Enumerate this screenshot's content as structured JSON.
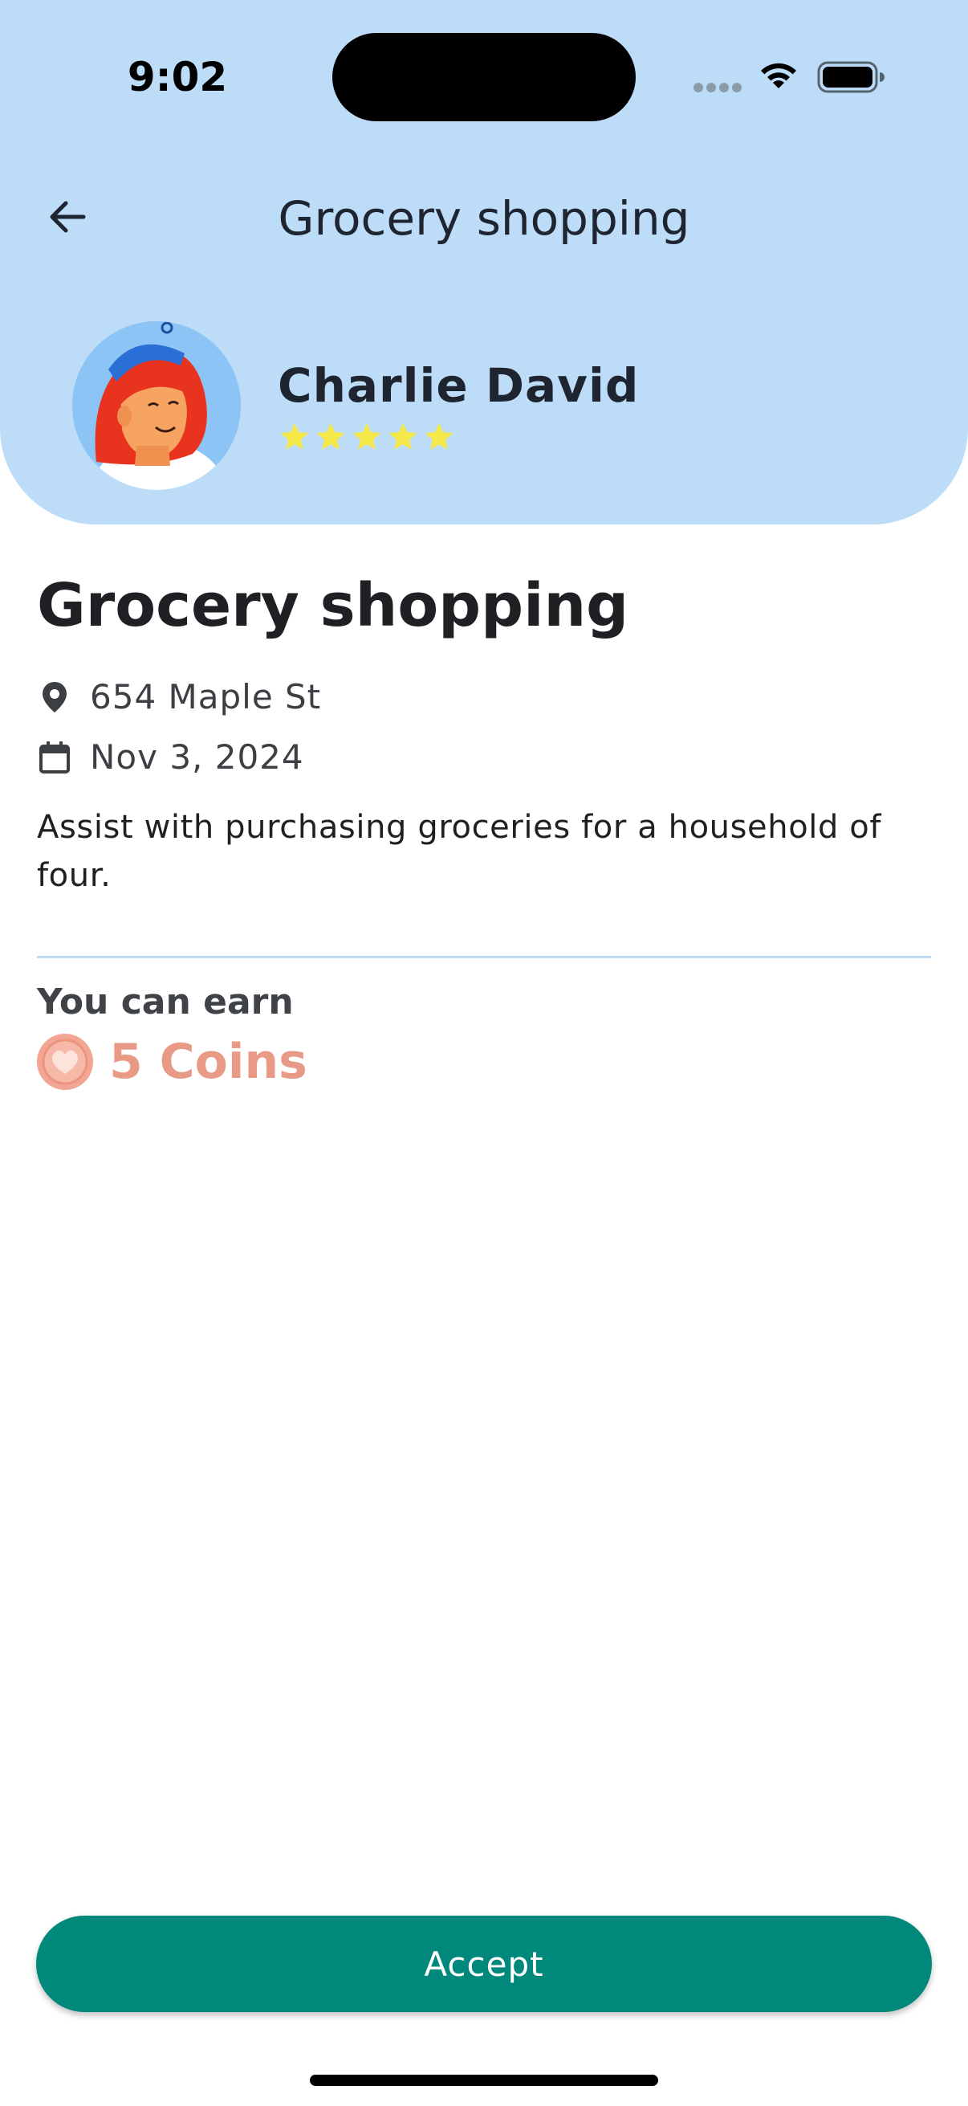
{
  "status_bar": {
    "time": "9:02",
    "icons": [
      "signal-dots-icon",
      "wifi-icon",
      "battery-icon"
    ]
  },
  "header": {
    "title": "Grocery shopping",
    "back_icon": "arrow-left-icon",
    "background_color": "#bddcf7"
  },
  "requester": {
    "name": "Charlie David",
    "rating": 5,
    "rating_max": 5,
    "star_color": "#f5e94a"
  },
  "task": {
    "title": "Grocery shopping",
    "location": "654 Maple St",
    "location_icon": "map-pin-icon",
    "date": "Nov 3, 2024",
    "date_icon": "calendar-icon",
    "description": "Assist with purchasing groceries for a household of four."
  },
  "reward": {
    "label": "You can earn",
    "amount_text": "5 Coins",
    "coin_icon": "heart-coin-icon",
    "color": "#e99a86"
  },
  "actions": {
    "accept_label": "Accept",
    "accept_color": "#00897b"
  }
}
